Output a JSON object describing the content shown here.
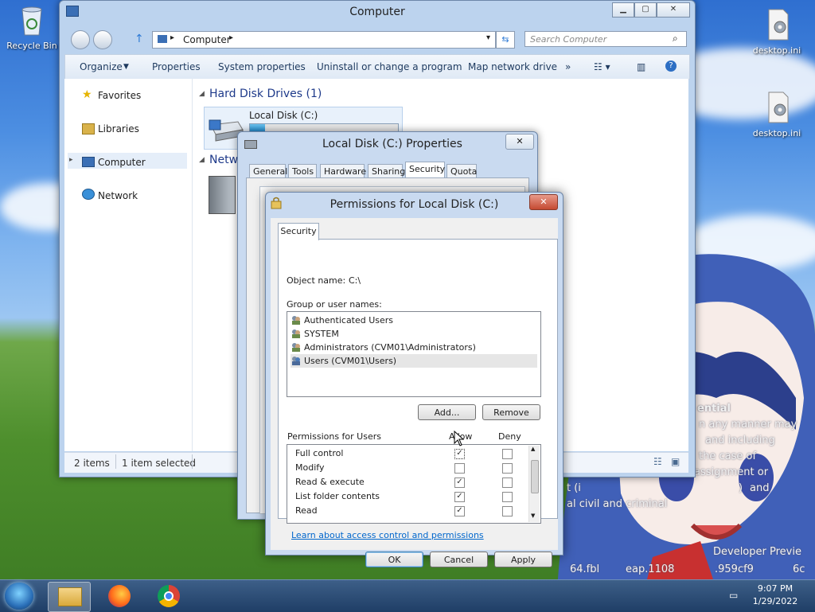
{
  "desktop": {
    "icons": [
      {
        "label": "Recycle Bin",
        "icon": "recycle-bin-icon"
      },
      {
        "label": "desktop.ini",
        "icon": "settings-file-icon"
      },
      {
        "label": "desktop.ini",
        "icon": "settings-file-icon"
      }
    ],
    "overlay_lines": [
      "ential",
      "n any manner may",
      "and including",
      "the case of",
      "assignment or",
      "t (i",
      ")",
      "and",
      "al civil and criminal",
      "Developer Previe",
      "64.fbl",
      "eap.1108",
      ".959cf9",
      "6c"
    ]
  },
  "explorer": {
    "title": "Computer",
    "address": "Computer",
    "search_placeholder": "Search Computer",
    "toolbar": [
      "Organize",
      "Properties",
      "System properties",
      "Uninstall or change a program",
      "Map network drive",
      "»"
    ],
    "nav": [
      "Favorites",
      "Libraries",
      "Computer",
      "Network"
    ],
    "section_hdd": "Hard Disk Drives (1)",
    "drive_label": "Local Disk (C:)",
    "section_net": "Netw",
    "status_items": "2 items",
    "status_selected": "1 item selected"
  },
  "props": {
    "title": "Local Disk (C:) Properties",
    "close": "✕",
    "tabs": [
      "General",
      "Tools",
      "Hardware",
      "Sharing",
      "Security",
      "Quota"
    ],
    "active_tab": "Security"
  },
  "permissions": {
    "title": "Permissions for Local Disk (C:)",
    "close": "✕",
    "tab": "Security",
    "object_label": "Object name:",
    "object_value": "C:\\",
    "group_label": "Group or user names:",
    "users": [
      "Authenticated Users",
      "SYSTEM",
      "Administrators (CVM01\\Administrators)",
      "Users (CVM01\\Users)"
    ],
    "selected_user_index": 3,
    "add_button": "Add...",
    "remove_button": "Remove",
    "perm_for_label": "Permissions for Users",
    "allow_label": "Allow",
    "deny_label": "Deny",
    "rows": [
      {
        "name": "Full control",
        "allow": true,
        "deny": false
      },
      {
        "name": "Modify",
        "allow": false,
        "deny": false
      },
      {
        "name": "Read & execute",
        "allow": true,
        "deny": false
      },
      {
        "name": "List folder contents",
        "allow": true,
        "deny": false
      },
      {
        "name": "Read",
        "allow": true,
        "deny": false
      }
    ],
    "learn_link": "Learn about access control and permissions",
    "ok": "OK",
    "cancel": "Cancel",
    "apply": "Apply"
  },
  "taskbar": {
    "time": "9:07 PM",
    "date": "1/29/2022"
  }
}
